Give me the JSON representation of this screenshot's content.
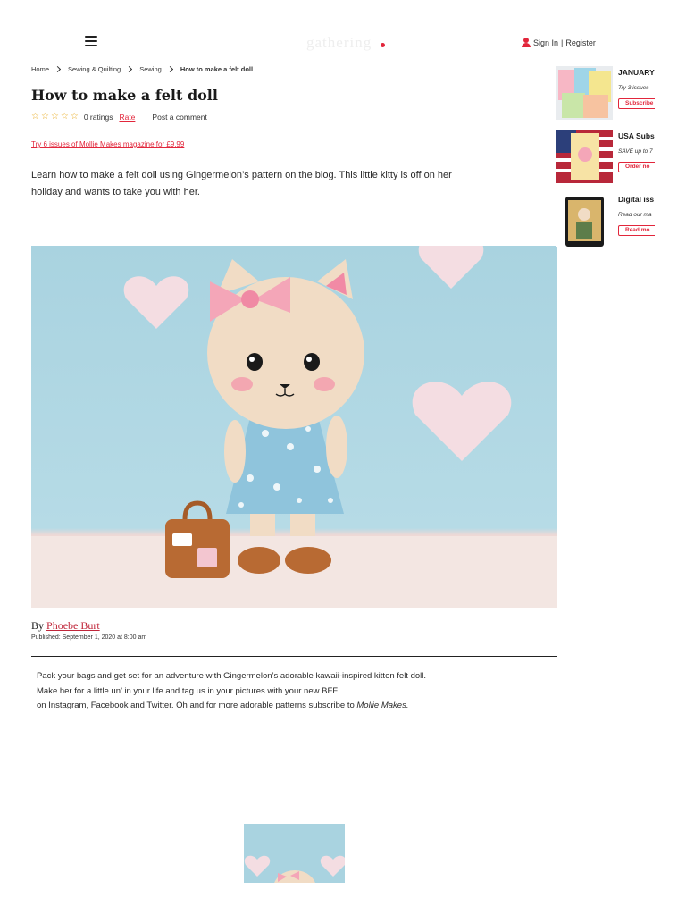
{
  "header": {
    "logo_text": "gathering",
    "signin_label": "Sign In",
    "separator": "|",
    "register_label": "Register"
  },
  "breadcrumb": [
    "Home",
    "Sewing & Quilting",
    "Sewing",
    "How to make a felt doll"
  ],
  "article": {
    "title": "How to make a felt doll",
    "ratings_text": "0 ratings",
    "rate_label": "Rate",
    "comment_label": "Post a comment",
    "promo_link": "Try 6 issues of Mollie Makes magazine for £9.99",
    "intro": "Learn how to make a felt doll using Gingermelon’s pattern on the blog. This little kitty is off on her holiday and wants to take you with her.",
    "by_label": "By",
    "author": "Phoebe Burt",
    "published": "Published: September 1, 2020 at 8:00 am",
    "body_line1": "Pack your bags and get set for an adventure with Gingermelon’s adorable kawaii-inspired kitten felt doll.",
    "body_line2": "Make her for a little un’ in your life and tag us in your pictures with your new BFF",
    "body_line3": "on Instagram, Facebook and Twitter. Oh and for more adorable patterns subscribe to",
    "body_magazine": "Mollie Makes."
  },
  "sidebar": [
    {
      "title": "JANUARY",
      "desc": "Try 3 issues",
      "button": "Subscribe"
    },
    {
      "title": "USA Subs",
      "desc": "SAVE up to 7",
      "button": "Order no"
    },
    {
      "title": "Digital iss",
      "desc": "Read our ma",
      "button": "Read mo"
    }
  ],
  "colors": {
    "accent": "#e2263b",
    "star": "#e8a81a",
    "sky": "#a9d3e0"
  }
}
